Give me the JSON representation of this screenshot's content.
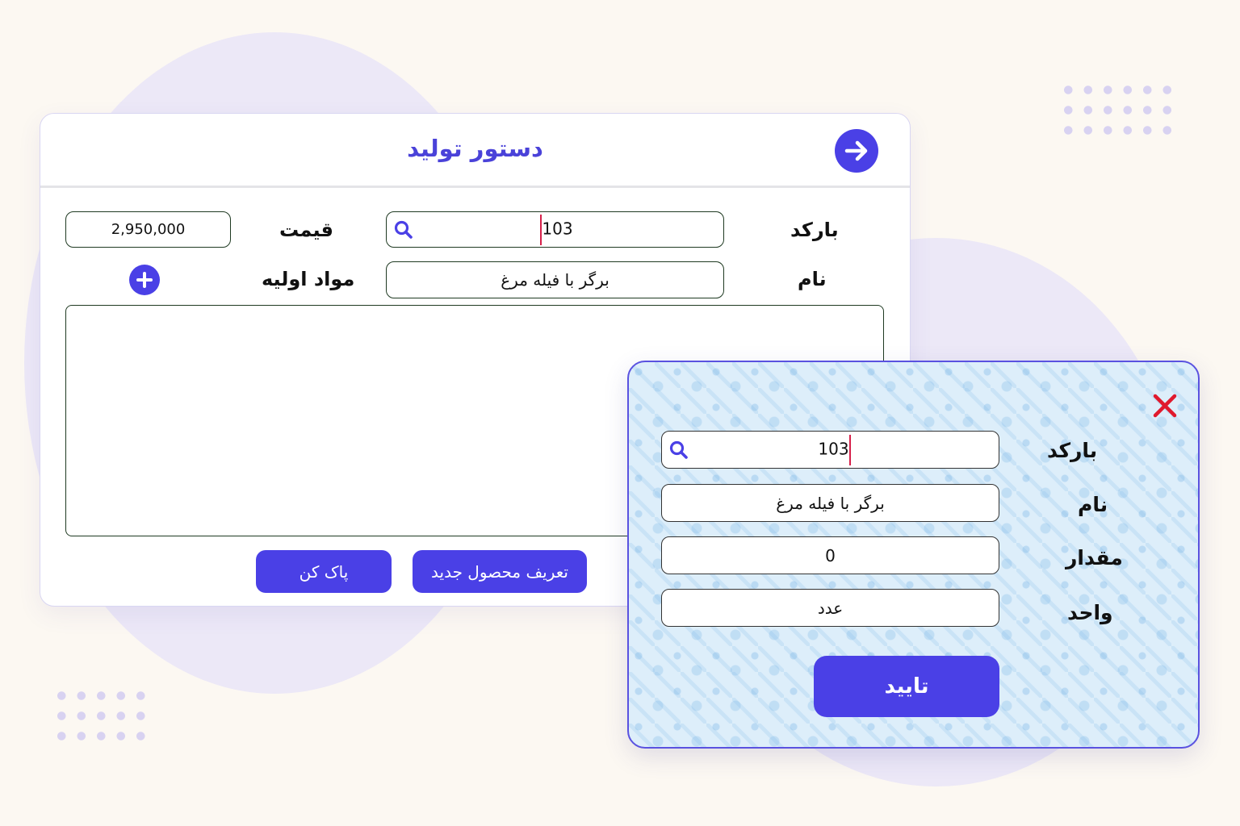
{
  "main": {
    "title": "دستور تولید",
    "barcode_label": "بارکد",
    "barcode_value": "103",
    "price_label": "قیمت",
    "price_value": "2,950,000",
    "name_label": "نام",
    "name_value": "برگر با فیله مرغ",
    "materials_label": "مواد اولیه",
    "new_product_button": "تعریف محصول جدید",
    "clear_button": "پاک کن"
  },
  "popup": {
    "barcode_label": "بارکد",
    "barcode_value": "103",
    "name_label": "نام",
    "name_value": "برگر با فیله مرغ",
    "quantity_label": "مقدار",
    "quantity_value": "0",
    "unit_label": "واحد",
    "unit_value": "عدد",
    "confirm_button": "تایید"
  },
  "icons": {
    "back": "arrow-right-circle-icon",
    "search": "search-icon",
    "add": "plus-circle-icon",
    "close": "close-icon"
  },
  "colors": {
    "accent": "#4a40e6",
    "title": "#4a42d9",
    "caret": "#d6204a",
    "close": "#e0192d"
  }
}
